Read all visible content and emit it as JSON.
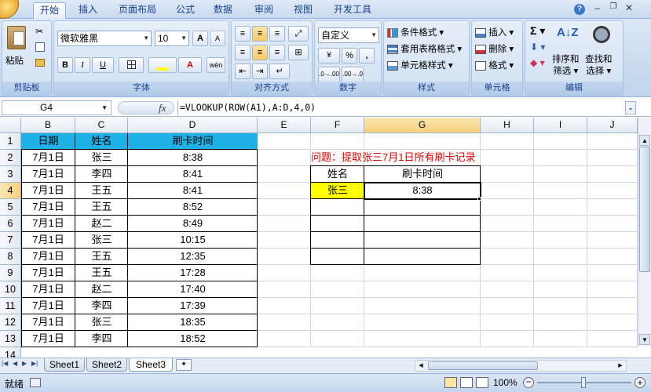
{
  "tabs": [
    "开始",
    "插入",
    "页面布局",
    "公式",
    "数据",
    "审阅",
    "视图",
    "开发工具"
  ],
  "clipboard": {
    "paste": "粘贴",
    "label": "剪贴板"
  },
  "font": {
    "name": "微软雅黑",
    "size": "10",
    "label": "字体",
    "bold": "B",
    "italic": "I",
    "underline": "U",
    "grow": "A",
    "shrink": "A"
  },
  "alignment": {
    "label": "对齐方式"
  },
  "number": {
    "format": "自定义",
    "label": "数字",
    "percent": "%",
    "comma": ","
  },
  "styles": {
    "cond": "条件格式",
    "table": "套用表格格式",
    "cell": "单元格样式",
    "label": "样式"
  },
  "cells": {
    "insert": "插入",
    "delete": "删除",
    "format": "格式",
    "label": "单元格"
  },
  "editing": {
    "sort": "排序和",
    "sort2": "筛选",
    "find": "查找和",
    "find2": "选择",
    "label": "编辑"
  },
  "namebox": "G4",
  "fx": "fx",
  "formula": "=VLOOKUP(ROW(A1),A:D,4,0)",
  "columns": [
    "B",
    "C",
    "D",
    "E",
    "F",
    "G",
    "H",
    "I",
    "J"
  ],
  "rows": [
    "1",
    "2",
    "3",
    "4",
    "5",
    "6",
    "7",
    "8",
    "9",
    "10",
    "11",
    "12",
    "13",
    "14"
  ],
  "table": {
    "headers": [
      "日期",
      "姓名",
      "刷卡时间"
    ],
    "rows": [
      [
        "7月1日",
        "张三",
        "8:38"
      ],
      [
        "7月1日",
        "李四",
        "8:41"
      ],
      [
        "7月1日",
        "王五",
        "8:41"
      ],
      [
        "7月1日",
        "王五",
        "8:52"
      ],
      [
        "7月1日",
        "赵二",
        "8:49"
      ],
      [
        "7月1日",
        "张三",
        "10:15"
      ],
      [
        "7月1日",
        "王五",
        "12:35"
      ],
      [
        "7月1日",
        "王五",
        "17:28"
      ],
      [
        "7月1日",
        "赵二",
        "17:40"
      ],
      [
        "7月1日",
        "李四",
        "17:39"
      ],
      [
        "7月1日",
        "张三",
        "18:35"
      ],
      [
        "7月1日",
        "李四",
        "18:52"
      ]
    ]
  },
  "question": "问题：提取张三7月1日所有刷卡记录",
  "lookup": {
    "h1": "姓名",
    "h2": "刷卡时间",
    "name": "张三",
    "time": "8:38"
  },
  "sheets": [
    "Sheet1",
    "Sheet2",
    "Sheet3"
  ],
  "status": "就绪",
  "zoom": "100%",
  "colors": {
    "header_fill": "#1fb0e6",
    "lookup_fill": "#ffff00",
    "question": "#e00000"
  }
}
